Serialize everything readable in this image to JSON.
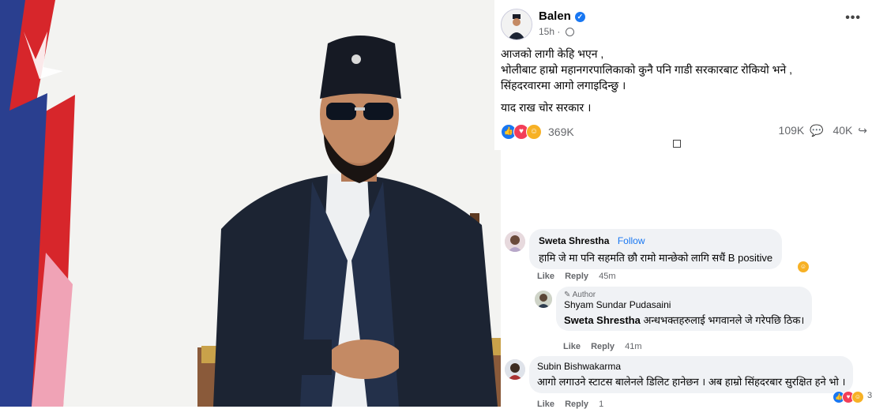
{
  "post": {
    "author": "Balen",
    "time": "15h",
    "dot": "·",
    "more": "•••",
    "lines": [
      "आजको लागी केहि भएन ,",
      "भोलीबाट हाम्रो महानगरपालिकाको कुनै पनि गाडी सरकारबाट रोकियो भने ,",
      "सिंहदरवारमा आगो लगाइदिन्छु ।"
    ],
    "closing": "याद राख चोर सरकार ।",
    "reaction_count": "369K",
    "comment_count": "109K",
    "share_count": "40K"
  },
  "comments": [
    {
      "name": "Sweta Shrestha",
      "follow": "Follow",
      "text": "हामि जे मा पनि सहमति छौ रामो मान्छेको लागि सधैं B positive",
      "like": "Like",
      "reply": "Reply",
      "time": "45m"
    },
    {
      "badge": "Author",
      "name": "Shyam Sundar Pudasaini",
      "mention": "Sweta Shrestha",
      "text": "अन्धभक्तहरुलाई भगवानले जे गरेपछि ठिक।",
      "like": "Like",
      "reply": "Reply",
      "time": "41m"
    },
    {
      "name": "Subin Bishwakarma",
      "text": "आगो लगाउने स्टाटस बालेनले डिलिट हानेछन । अब हाम्रो सिंहदरबार सुरक्षित हने भो ।",
      "like": "Like",
      "reply": "Reply",
      "time": "1",
      "reaction_count": "3"
    }
  ],
  "colors": {
    "accent": "#1877f2",
    "text": "#050505",
    "muted": "#65676b",
    "bubble": "#f0f2f5"
  }
}
